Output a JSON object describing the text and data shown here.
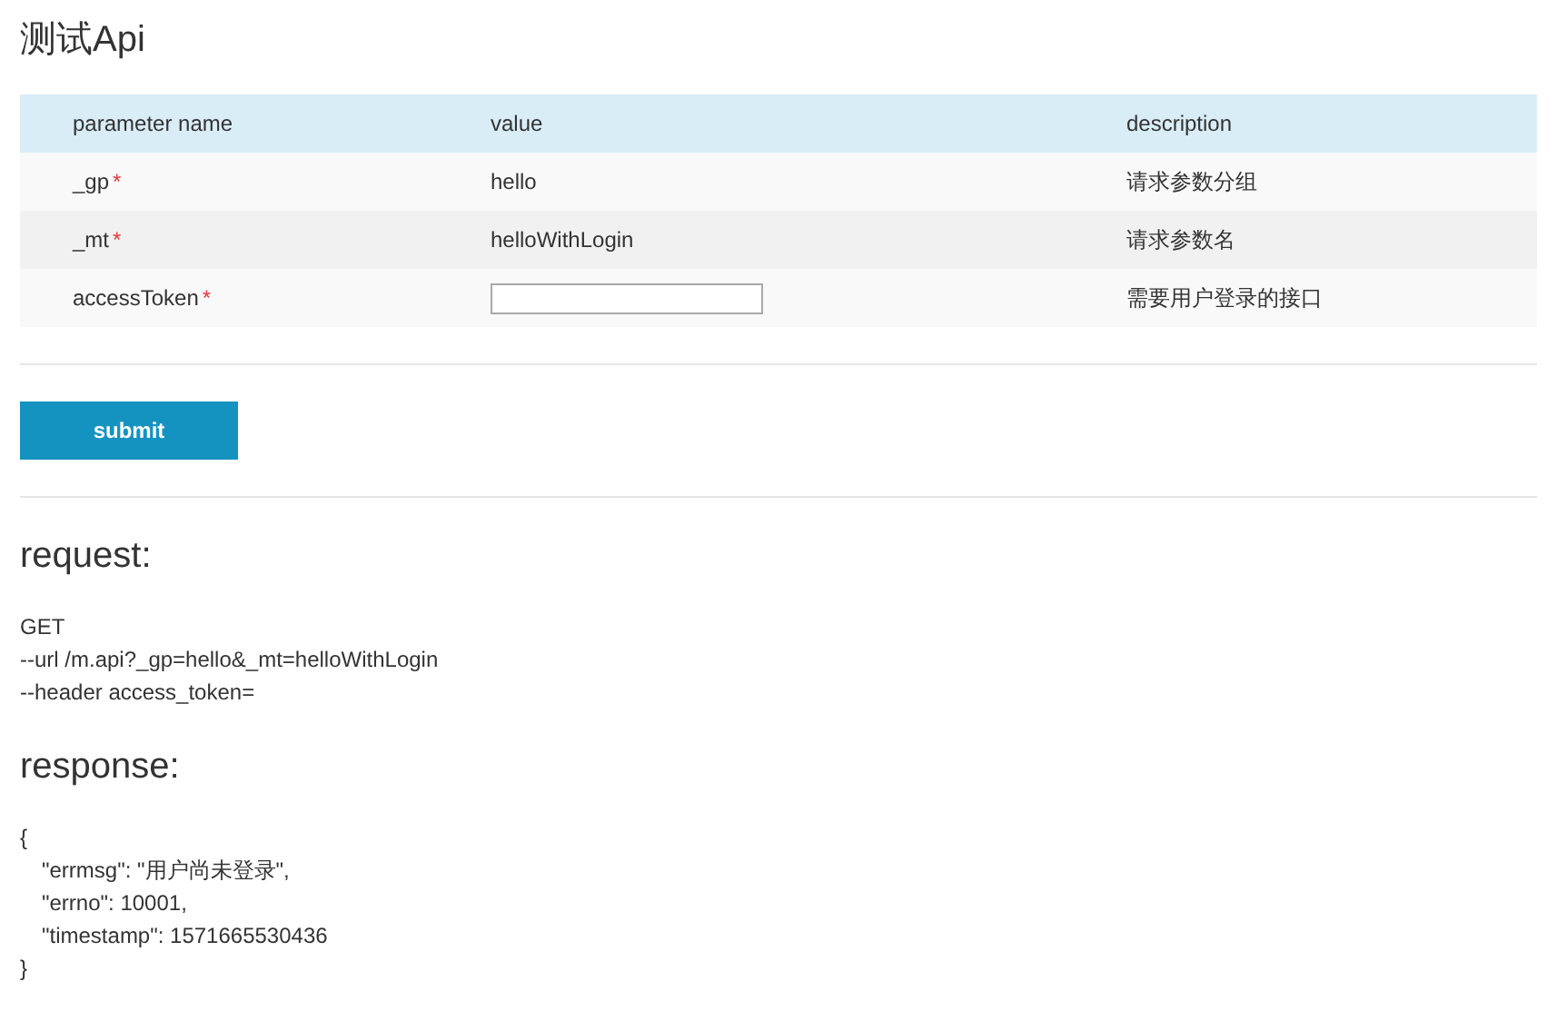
{
  "title": "测试Api",
  "table": {
    "columns": [
      "parameter name",
      "value",
      "description"
    ],
    "rows": [
      {
        "name": "_gp",
        "required": "*",
        "kind": "text",
        "value": "hello",
        "description": "请求参数分组"
      },
      {
        "name": "_mt",
        "required": "*",
        "kind": "text",
        "value": "helloWithLogin",
        "description": "请求参数名"
      },
      {
        "name": "accessToken",
        "required": "*",
        "kind": "input",
        "value": "",
        "description": "需要用户登录的接口"
      }
    ]
  },
  "submit": "submit",
  "request": {
    "heading": "request:",
    "lines": [
      "GET",
      "--url /m.api?_gp=hello&_mt=helloWithLogin",
      "--header access_token="
    ]
  },
  "response": {
    "heading": "response:",
    "open": "{",
    "lines": [
      "\"errmsg\": \"用户尚未登录\",",
      "\"errno\": 10001,",
      "\"timestamp\": 1571665530436"
    ],
    "close": "}"
  }
}
